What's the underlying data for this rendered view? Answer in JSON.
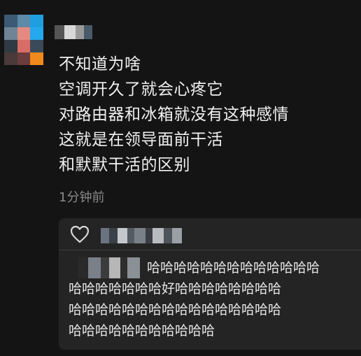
{
  "comment": {
    "lines": [
      "不知道为啥",
      "空调开久了就会心疼它",
      "对路由器和冰箱就没有这种感情",
      "这就是在领导面前干活",
      "和默默干活的区别"
    ],
    "timestamp": "1分钟前"
  },
  "reply": {
    "lines": [
      "哈哈哈哈哈哈哈哈哈哈哈哈哈",
      "哈哈哈哈哈哈哈好哈哈哈哈哈哈哈哈",
      "哈哈哈哈哈哈哈哈哈哈哈哈哈哈哈哈",
      "哈哈哈哈哈哈哈哈哈哈哈"
    ]
  },
  "icons": {
    "like": "heart-outline-icon"
  },
  "colors": {
    "background": "#141414",
    "reply_panel": "#242424",
    "text_primary": "#f0f0f0",
    "text_secondary": "#8a8a8a"
  }
}
